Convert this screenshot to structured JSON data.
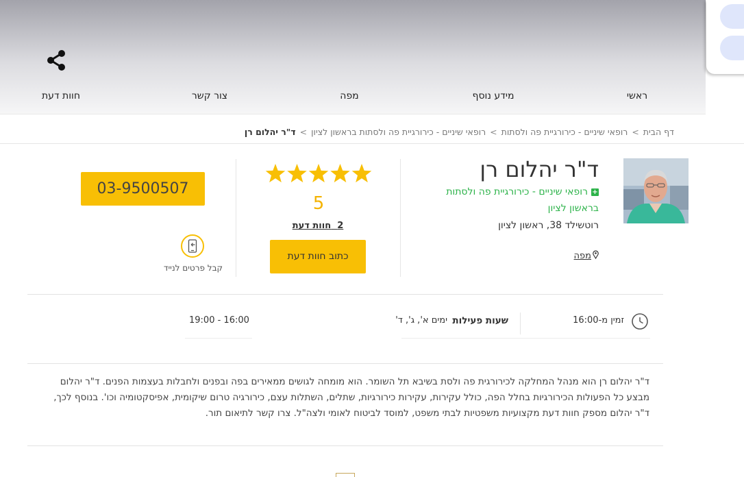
{
  "nav": {
    "items": [
      "ראשי",
      "מידע נוסף",
      "מפה",
      "צור קשר",
      "חוות דעת"
    ],
    "share_icon": "share-icon"
  },
  "breadcrumb": {
    "items": [
      "דף הבית",
      "רופאי שיניים - כירורגיית פה ולסתות",
      "רופאי שיניים - כירורגיית פה ולסתות בראשון לציון"
    ],
    "current": "ד\"ר יהלום רן",
    "separator": ">"
  },
  "doctor": {
    "name": "ד\"ר יהלום רן",
    "category": "רופאי שיניים - כירורגיית פה ולסתות בראשון לציון",
    "address": "רוטשילד 38, ראשון לציון",
    "map_label": "מפה"
  },
  "rating": {
    "value": "5",
    "stars_filled": 5,
    "stars_total": 5,
    "reviews_count": "2",
    "reviews_label": "חוות דעת",
    "write_review": "כתוב חוות דעת"
  },
  "contact": {
    "phone": "03-9500507",
    "mobile_label": "קבל פרטים לנייד"
  },
  "hours": {
    "available_from": "זמין מ-16:00",
    "title": "שעות פעילות",
    "days": "ימים א', ג', ד'",
    "range": "19:00 - 16:00"
  },
  "description": "ד\"ר יהלום רן הוא מנהל המחלקה לכירורגית פה ולסת בשיבא תל השומר. הוא מומחה לגושים ממאירים בפה ובפנים ולחבלות בעצמות הפנים. ד\"ר יהלום מבצע כל הפעולות הכירורגיות בחלל הפה, כולל עקירות, עקירות כירורגיות, שתלים, השתלות עצם, כירורגיה טרום שיקומית, אפיסקטומיה וכו'. בנוסף לכך, ד\"ר יהלום מספק חוות דעת מקצועיות משפטיות לבתי משפט, למוסד לביטוח לאומי ולצה\"ל. צרו קשר לתיאום תור.",
  "colors": {
    "accent": "#f8bf05",
    "star": "#f8bf05",
    "category_green": "#2db34a"
  }
}
